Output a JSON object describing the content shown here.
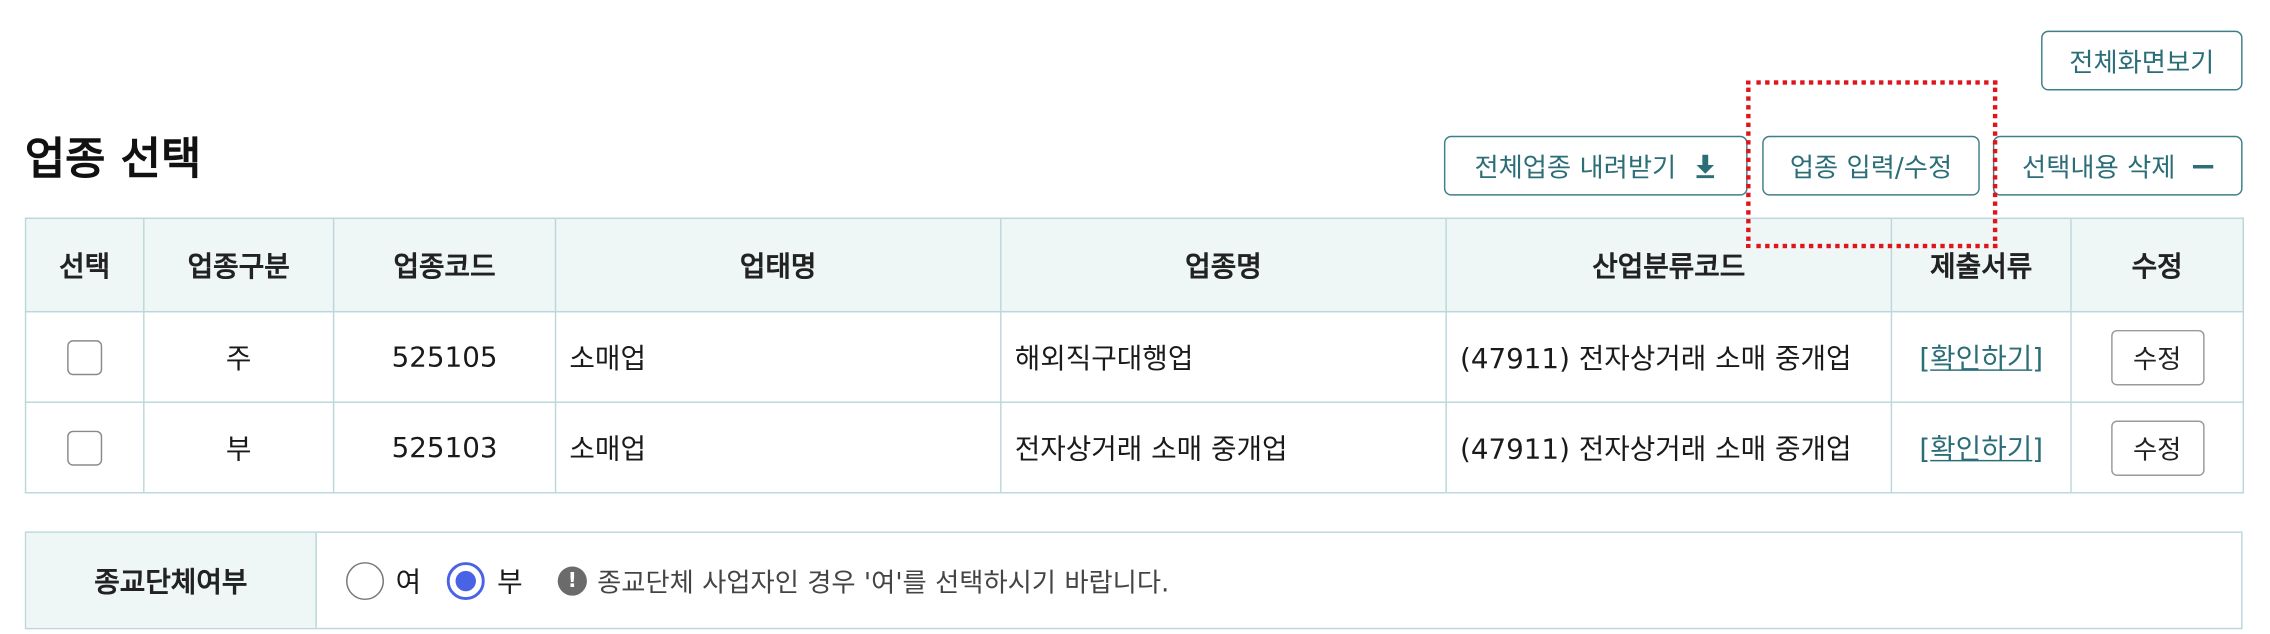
{
  "toolbar": {
    "fullscreen_label": "전체화면보기",
    "download_label": "전체업종 내려받기",
    "input_label": "업종 입력/수정",
    "delete_label": "선택내용 삭제"
  },
  "page_title": "업종 선택",
  "table": {
    "headers": [
      "선택",
      "업종구분",
      "업종코드",
      "업태명",
      "업종명",
      "산업분류코드",
      "제출서류",
      "수정"
    ],
    "rows": [
      {
        "division": "주",
        "code": "525105",
        "business_type": "소매업",
        "industry_name": "해외직구대행업",
        "classification": "(47911) 전자상거래 소매 중개업",
        "docs_link": "확인하기",
        "edit_label": "수정"
      },
      {
        "division": "부",
        "code": "525103",
        "business_type": "소매업",
        "industry_name": "전자상거래 소매 중개업",
        "classification": "(47911) 전자상거래 소매 중개업",
        "docs_link": "확인하기",
        "edit_label": "수정"
      }
    ]
  },
  "religion": {
    "label": "종교단체여부",
    "options": [
      {
        "label": "여",
        "selected": false
      },
      {
        "label": "부",
        "selected": true
      }
    ],
    "notice": "종교단체 사업자인 경우 '여'를 선택하시기 바랍니다."
  },
  "colors": {
    "accent": "#2c6e77",
    "header_bg": "#eef6f6",
    "border": "#bcd7da",
    "radio_selected": "#4a63e6",
    "highlight": "#e0151b"
  },
  "icons": {
    "download": "download-icon",
    "delete": "minus-icon",
    "notice": "exclamation-icon"
  }
}
